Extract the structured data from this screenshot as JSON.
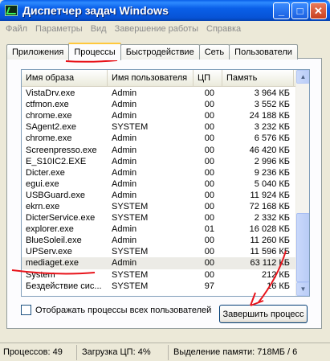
{
  "window": {
    "title": "Диспетчер задач Windows"
  },
  "menu": [
    "Файл",
    "Параметры",
    "Вид",
    "Завершение работы",
    "Справка"
  ],
  "tabs": [
    "Приложения",
    "Процессы",
    "Быстродействие",
    "Сеть",
    "Пользователи"
  ],
  "table": {
    "columns": [
      "Имя образа",
      "Имя пользователя",
      "ЦП",
      "Память"
    ],
    "rows": [
      [
        "VistaDrv.exe",
        "Admin",
        "00",
        "3 964 КБ"
      ],
      [
        "ctfmon.exe",
        "Admin",
        "00",
        "3 552 КБ"
      ],
      [
        "chrome.exe",
        "Admin",
        "00",
        "24 188 КБ"
      ],
      [
        "SAgent2.exe",
        "SYSTEM",
        "00",
        "3 232 КБ"
      ],
      [
        "chrome.exe",
        "Admin",
        "00",
        "6 576 КБ"
      ],
      [
        "Screenpresso.exe",
        "Admin",
        "00",
        "46 420 КБ"
      ],
      [
        "E_S10IC2.EXE",
        "Admin",
        "00",
        "2 996 КБ"
      ],
      [
        "Dicter.exe",
        "Admin",
        "00",
        "9 236 КБ"
      ],
      [
        "egui.exe",
        "Admin",
        "00",
        "5 040 КБ"
      ],
      [
        "USBGuard.exe",
        "Admin",
        "00",
        "11 924 КБ"
      ],
      [
        "ekrn.exe",
        "SYSTEM",
        "00",
        "72 168 КБ"
      ],
      [
        "DicterService.exe",
        "SYSTEM",
        "00",
        "2 332 КБ"
      ],
      [
        "explorer.exe",
        "Admin",
        "01",
        "16 028 КБ"
      ],
      [
        "BlueSoleil.exe",
        "Admin",
        "00",
        "11 260 КБ"
      ],
      [
        "UPServ.exe",
        "SYSTEM",
        "00",
        "11 596 КБ"
      ],
      [
        "mediaget.exe",
        "Admin",
        "00",
        "63 112 КБ"
      ],
      [
        "System",
        "SYSTEM",
        "00",
        "212 КБ"
      ],
      [
        "Бездействие сис...",
        "SYSTEM",
        "97",
        "16 КБ"
      ]
    ],
    "selected_index": 15
  },
  "show_all_label": "Отображать процессы всех пользователей",
  "end_process_label": "Завершить процесс",
  "status": {
    "processes": "Процессов: 49",
    "cpu": "Загрузка ЦП: 4%",
    "memory": "Выделение памяти: 718МБ / 6"
  }
}
